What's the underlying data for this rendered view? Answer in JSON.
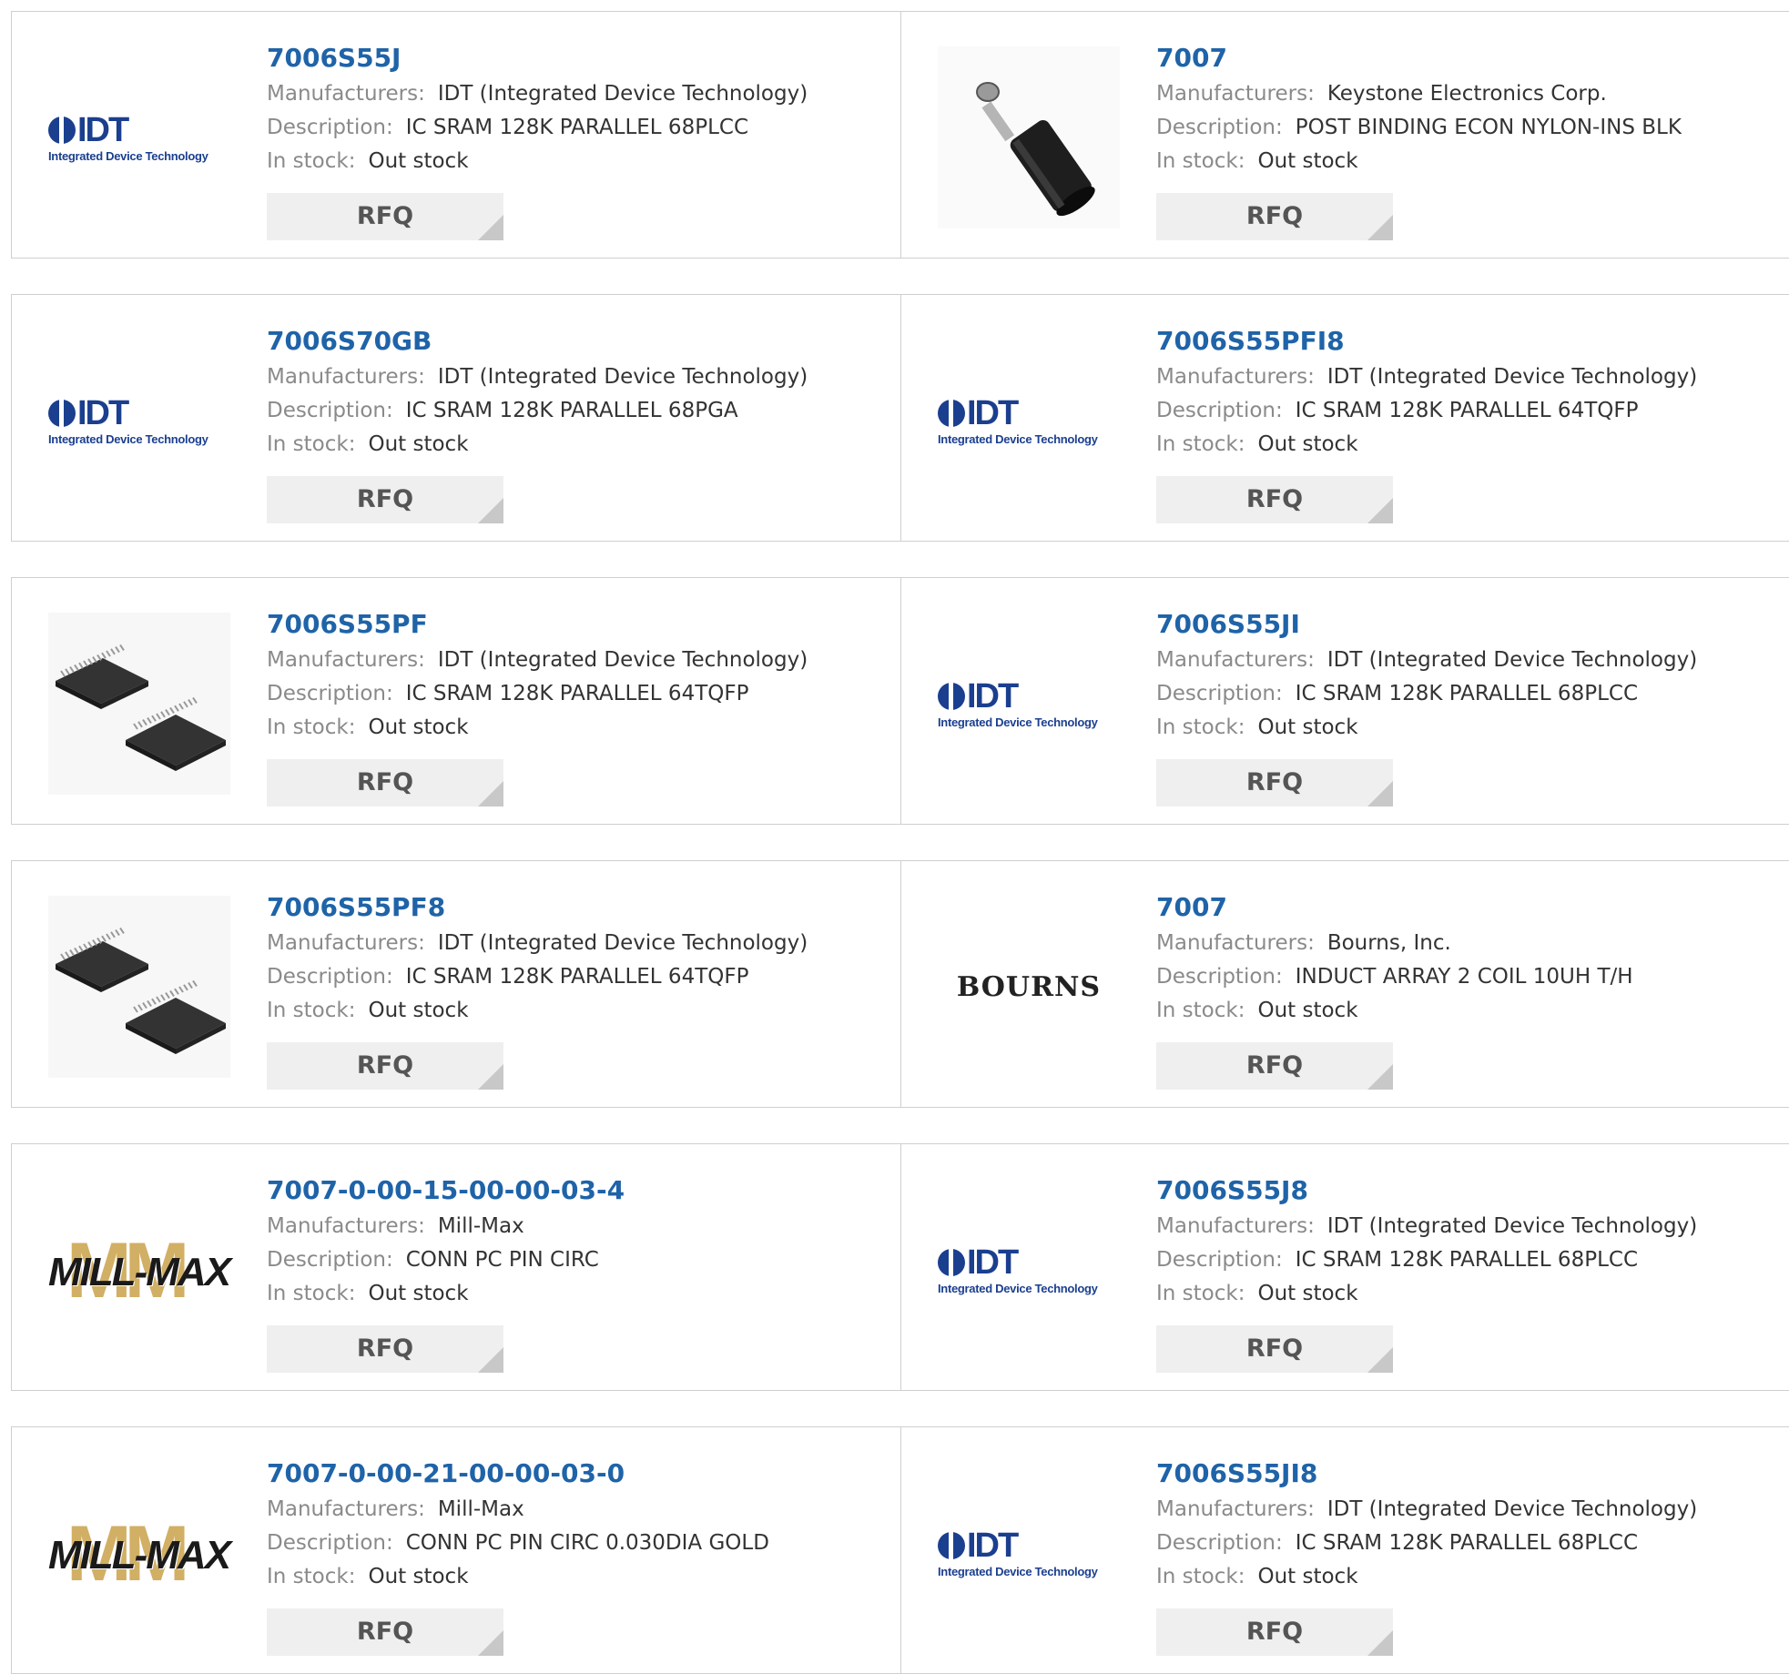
{
  "labels": {
    "manufacturers": "Manufacturers:",
    "description": "Description:",
    "in_stock": "In stock:",
    "rfq": "RFQ"
  },
  "logos": {
    "idt_text": "IDT",
    "idt_sub": "Integrated Device Technology",
    "bourns_text": "BOURNS",
    "millmax_text": "MILL-MAX"
  },
  "colors": {
    "part_link": "#1f63a8",
    "label": "#8a8a8a",
    "value": "#333333",
    "rfq_bg": "#efefef"
  },
  "products": [
    {
      "part": "7006S55J",
      "manufacturer": "IDT (Integrated Device Technology)",
      "description": "IC SRAM 128K PARALLEL 68PLCC",
      "stock": "Out stock",
      "image": "idt-logo"
    },
    {
      "part": "7007",
      "manufacturer": "Keystone Electronics Corp.",
      "description": "POST BINDING ECON NYLON-INS BLK",
      "stock": "Out stock",
      "image": "binding-post-photo"
    },
    {
      "part": "7006S70GB",
      "manufacturer": "IDT (Integrated Device Technology)",
      "description": "IC SRAM 128K PARALLEL 68PGA",
      "stock": "Out stock",
      "image": "idt-logo"
    },
    {
      "part": "7006S55PFI8",
      "manufacturer": "IDT (Integrated Device Technology)",
      "description": "IC SRAM 128K PARALLEL 64TQFP",
      "stock": "Out stock",
      "image": "idt-logo"
    },
    {
      "part": "7006S55PF",
      "manufacturer": "IDT (Integrated Device Technology)",
      "description": "IC SRAM 128K PARALLEL 64TQFP",
      "stock": "Out stock",
      "image": "tqfp-chip-photo"
    },
    {
      "part": "7006S55JI",
      "manufacturer": "IDT (Integrated Device Technology)",
      "description": "IC SRAM 128K PARALLEL 68PLCC",
      "stock": "Out stock",
      "image": "idt-logo"
    },
    {
      "part": "7006S55PF8",
      "manufacturer": "IDT (Integrated Device Technology)",
      "description": "IC SRAM 128K PARALLEL 64TQFP",
      "stock": "Out stock",
      "image": "tqfp-chip-photo"
    },
    {
      "part": "7007",
      "manufacturer": "Bourns, Inc.",
      "description": "INDUCT ARRAY 2 COIL 10UH T/H",
      "stock": "Out stock",
      "image": "bourns-logo"
    },
    {
      "part": "7007-0-00-15-00-00-03-4",
      "manufacturer": "Mill-Max",
      "description": "CONN PC PIN CIRC",
      "stock": "Out stock",
      "image": "millmax-logo"
    },
    {
      "part": "7006S55J8",
      "manufacturer": "IDT (Integrated Device Technology)",
      "description": "IC SRAM 128K PARALLEL 68PLCC",
      "stock": "Out stock",
      "image": "idt-logo"
    },
    {
      "part": "7007-0-00-21-00-00-03-0",
      "manufacturer": "Mill-Max",
      "description": "CONN PC PIN CIRC 0.030DIA GOLD",
      "stock": "Out stock",
      "image": "millmax-logo"
    },
    {
      "part": "7006S55JI8",
      "manufacturer": "IDT (Integrated Device Technology)",
      "description": "IC SRAM 128K PARALLEL 68PLCC",
      "stock": "Out stock",
      "image": "idt-logo"
    }
  ]
}
